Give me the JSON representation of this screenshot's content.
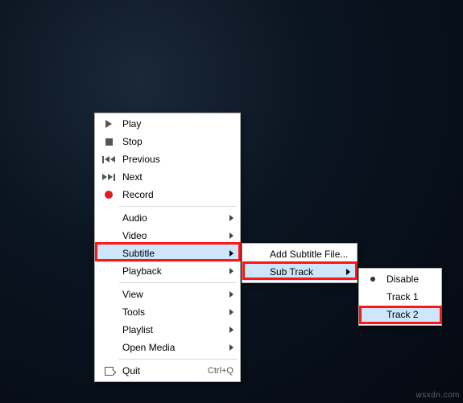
{
  "watermark": "wsxdn.com",
  "main_menu": {
    "play": "Play",
    "stop": "Stop",
    "previous": "Previous",
    "next": "Next",
    "record": "Record",
    "audio": "Audio",
    "video": "Video",
    "subtitle": "Subtitle",
    "playback": "Playback",
    "view": "View",
    "tools": "Tools",
    "playlist": "Playlist",
    "open_media": "Open Media",
    "quit": "Quit",
    "quit_shortcut": "Ctrl+Q"
  },
  "subtitle_menu": {
    "add_file": "Add Subtitle File...",
    "sub_track": "Sub Track"
  },
  "subtrack_menu": {
    "disable": "Disable",
    "track1": "Track 1",
    "track2": "Track 2"
  },
  "highlights": {
    "subtitle": true,
    "sub_track": true,
    "track2": true
  }
}
